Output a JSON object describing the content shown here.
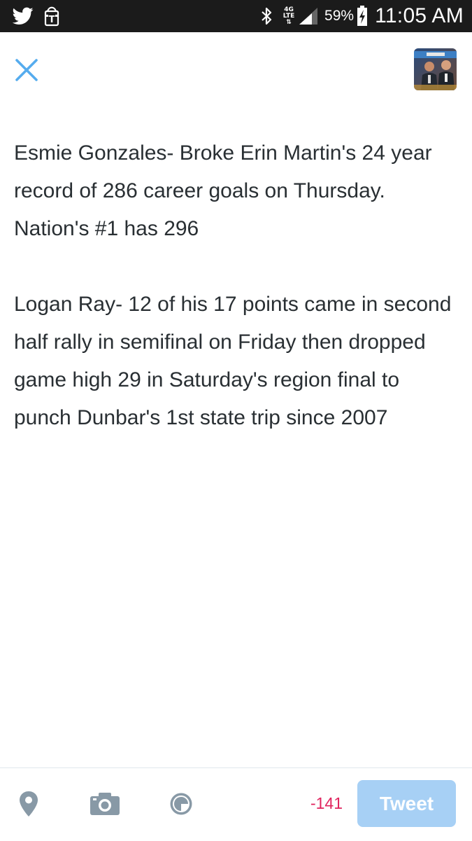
{
  "status_bar": {
    "left_icons": [
      "twitter-icon",
      "tmobile-icon"
    ],
    "network_top": "4G",
    "network_bottom": "LTE",
    "battery_percent": "59%",
    "time": "11:05 AM"
  },
  "header": {
    "close_icon": "close-icon",
    "avatar": "user-avatar"
  },
  "compose": {
    "text": "Esmie Gonzales- Broke Erin Martin's 24 year record of 286 career goals on Thursday. Nation's #1 has 296\n\nLogan Ray- 12 of his 17 points came in second half rally in semifinal on Friday then dropped game high 29 in Saturday's region final to punch Dunbar's 1st state trip since 2007"
  },
  "toolbar": {
    "location_icon": "location-pin-icon",
    "camera_icon": "camera-icon",
    "poll_icon": "poll-icon",
    "char_count": "-141",
    "tweet_label": "Tweet"
  },
  "colors": {
    "accent": "#55acee",
    "tweet_button_disabled": "#a7d0f5",
    "over_limit": "#e0245e",
    "toolbar_icon": "#8899a6",
    "text": "#292f33"
  }
}
